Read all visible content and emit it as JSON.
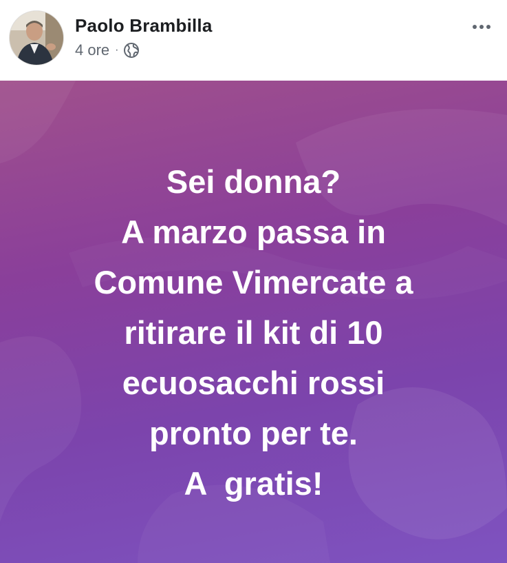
{
  "post": {
    "author": "Paolo Brambilla",
    "timestamp": "4 ore",
    "separator": "·",
    "privacy_icon": "globe-icon",
    "more_icon": "more-options-icon",
    "text_lines": [
      "Sei donna?",
      "A marzo passa in",
      "Comune Vimercate a",
      "ritirare il kit di 10",
      "ecuosacchi rossi",
      "pronto per te.",
      "A  gratis!"
    ]
  },
  "colors": {
    "background_top": "#a0508c",
    "background_bottom": "#7e53c0",
    "text": "#ffffff",
    "author_text": "#1c1e21",
    "meta_text": "#606770"
  }
}
